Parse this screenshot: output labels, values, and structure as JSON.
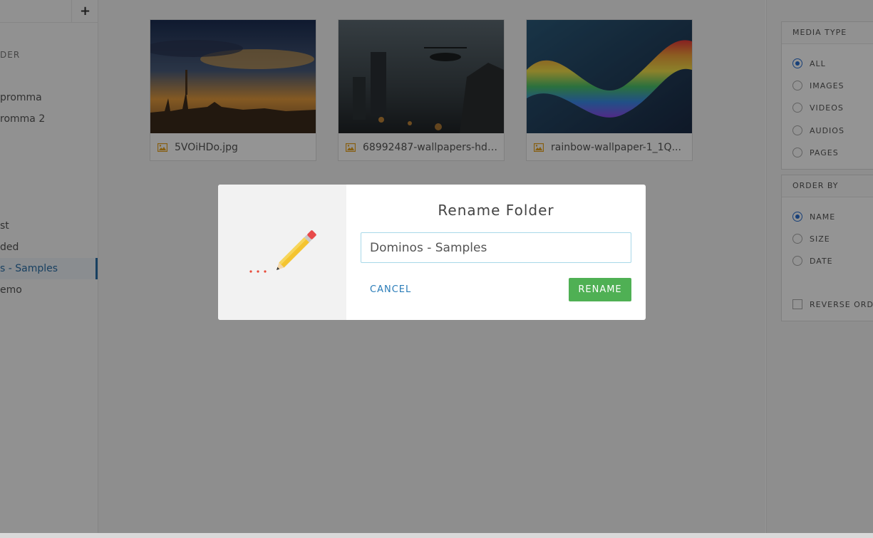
{
  "sidebar": {
    "add_label": "+",
    "heading": "DER",
    "items": [
      {
        "label": ""
      },
      {
        "label": "promma"
      },
      {
        "label": "romma 2"
      },
      {
        "label": "st"
      },
      {
        "label": "ded"
      },
      {
        "label": "s - Samples"
      },
      {
        "label": "emo"
      }
    ]
  },
  "media": [
    {
      "name": "5VOiHDo.jpg",
      "type_icon": "image-icon"
    },
    {
      "name": "68992487-wallpapers-hd-...",
      "type_icon": "image-icon"
    },
    {
      "name": "rainbow-wallpaper-1_1Q...",
      "type_icon": "image-icon"
    }
  ],
  "filters": {
    "media_type": {
      "title": "MEDIA TYPE",
      "options": [
        "ALL",
        "IMAGES",
        "VIDEOS",
        "AUDIOS",
        "PAGES"
      ],
      "selected": "ALL"
    },
    "order_by": {
      "title": "ORDER BY",
      "options": [
        "NAME",
        "SIZE",
        "DATE"
      ],
      "selected": "NAME",
      "reverse_label": "REVERSE ORDER"
    }
  },
  "modal": {
    "title": "Rename Folder",
    "input_value": "Dominos - Samples",
    "cancel_label": "CANCEL",
    "rename_label": "RENAME"
  },
  "colors": {
    "accent_blue": "#2a6fd0",
    "rename_green": "#4fb054",
    "link_blue": "#2a7cb8",
    "image_icon_orange": "#e8a21a"
  }
}
